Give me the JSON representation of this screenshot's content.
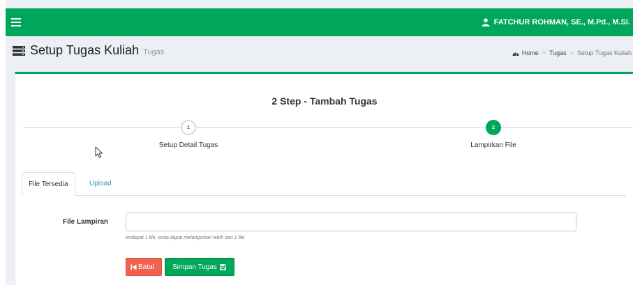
{
  "header": {
    "user_name": "FATCHUR ROHMAN, SE., M.Pd., M.Si.",
    "colors": {
      "brand": "#00a65a",
      "danger": "#f0624f",
      "link": "#3c8dbc"
    }
  },
  "page": {
    "title": "Setup Tugas Kuliah",
    "subtitle": "Tugas",
    "breadcrumb": [
      "Home",
      "Tugas",
      "Setup Tugas Kuliah"
    ]
  },
  "wizard": {
    "title": "2 Step - Tambah Tugas",
    "steps": [
      {
        "number": "1",
        "label": "Setup Detail Tugas",
        "state": "done"
      },
      {
        "number": "2",
        "label": "Lampirkan File",
        "state": "active"
      }
    ]
  },
  "tabs": [
    {
      "label": "File Tersedia",
      "active": true
    },
    {
      "label": "Upload",
      "active": false
    }
  ],
  "form": {
    "file_label": "File Lampiran",
    "file_value": "",
    "help_text": "terdapat 1 file, anda dapat melampirkan lebih dari 1 file",
    "cancel_label": "Batal",
    "save_label": "Simpan Tugas"
  },
  "icons": [
    "menu-icon",
    "user-icon",
    "server-icon",
    "dashboard-icon",
    "cursor-icon",
    "step-back-icon",
    "save-icon"
  ]
}
